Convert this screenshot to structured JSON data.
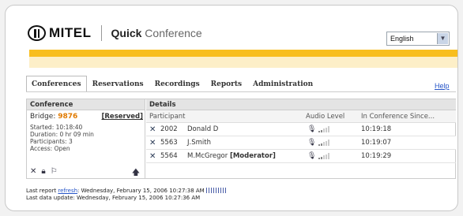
{
  "header": {
    "brand": "MITEL",
    "product_bold": "Quick",
    "product_light": "Conference",
    "language": "English"
  },
  "tabs": [
    {
      "label": "Conferences"
    },
    {
      "label": "Reservations"
    },
    {
      "label": "Recordings"
    },
    {
      "label": "Reports"
    },
    {
      "label": "Administration"
    }
  ],
  "help_label": "Help",
  "conference": {
    "heading": "Conference",
    "bridge_label": "Bridge:",
    "bridge_number": "9876",
    "reserved": "[Reserved]",
    "started": "Started: 10:18:40",
    "duration": "Duration: 0 hr 09 min",
    "participants": "Participants: 3",
    "access": "Access: Open"
  },
  "details": {
    "heading": "Details",
    "columns": {
      "participant": "Participant",
      "audio": "Audio Level",
      "since": "In Conference Since..."
    },
    "rows": [
      {
        "ext": "2002",
        "name": "Donald D",
        "role": "",
        "since": "10:19:18"
      },
      {
        "ext": "5563",
        "name": "J.Smith",
        "role": "",
        "since": "10:19:07"
      },
      {
        "ext": "5564",
        "name": "M.McGregor",
        "role": "[Moderator]",
        "since": "10:19:29"
      }
    ]
  },
  "footer": {
    "report_prefix": "Last report",
    "refresh_label": "refresh",
    "report_suffix": ": Wednesday, February 15, 2006 10:27:38 AM",
    "data_update": "Last data update: Wednesday, February 15, 2006 10:27:36 AM"
  },
  "colors": {
    "accent": "#f8be1e",
    "bridge": "#e07a00",
    "link": "#2554c7"
  }
}
